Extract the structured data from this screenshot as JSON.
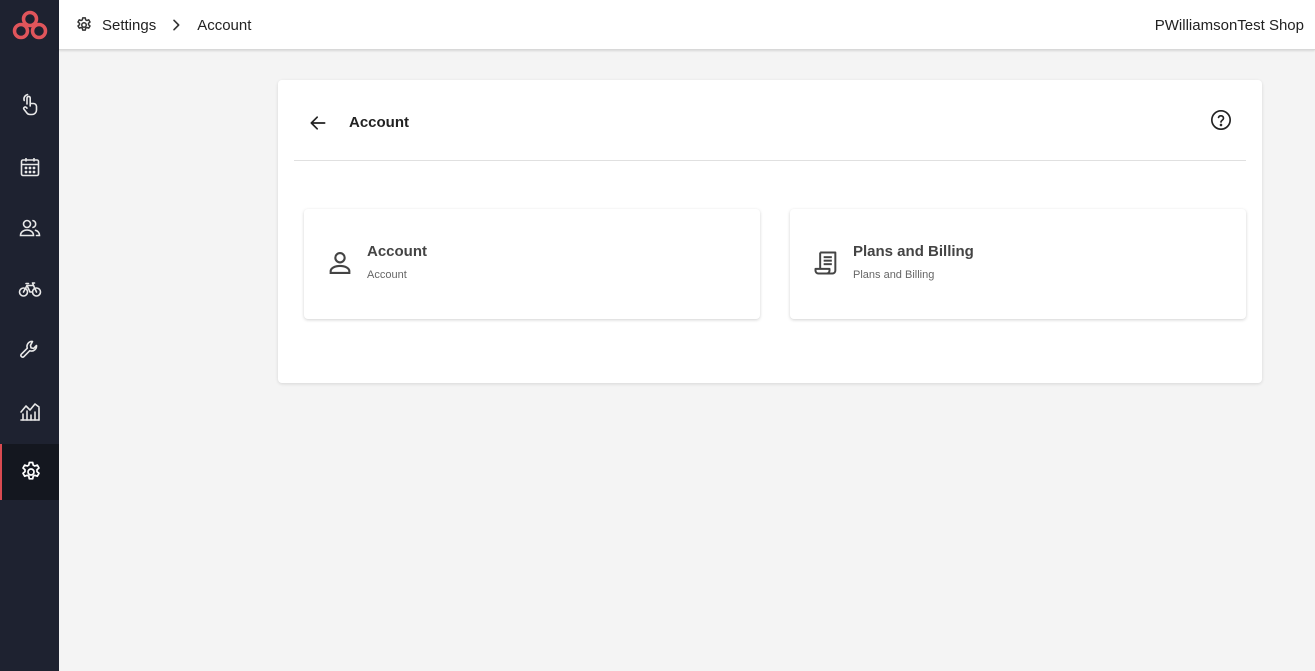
{
  "breadcrumb": {
    "root": "Settings",
    "current": "Account"
  },
  "header": {
    "shop_name": "PWilliamsonTest Shop"
  },
  "panel": {
    "title": "Account"
  },
  "cards": [
    {
      "title": "Account",
      "subtitle": "Account",
      "icon": "person-icon"
    },
    {
      "title": "Plans and Billing",
      "subtitle": "Plans and Billing",
      "icon": "receipt-icon"
    }
  ],
  "sidebar": {
    "items": [
      {
        "icon": "touch-icon",
        "active": false
      },
      {
        "icon": "calendar-icon",
        "active": false
      },
      {
        "icon": "people-icon",
        "active": false
      },
      {
        "icon": "bicycle-icon",
        "active": false
      },
      {
        "icon": "wrench-icon",
        "active": false
      },
      {
        "icon": "analytics-icon",
        "active": false
      },
      {
        "icon": "gear-icon",
        "active": true
      }
    ]
  },
  "colors": {
    "sidebar_bg": "#1e2230",
    "accent": "#d94a50",
    "page_bg": "#f4f4f4"
  }
}
